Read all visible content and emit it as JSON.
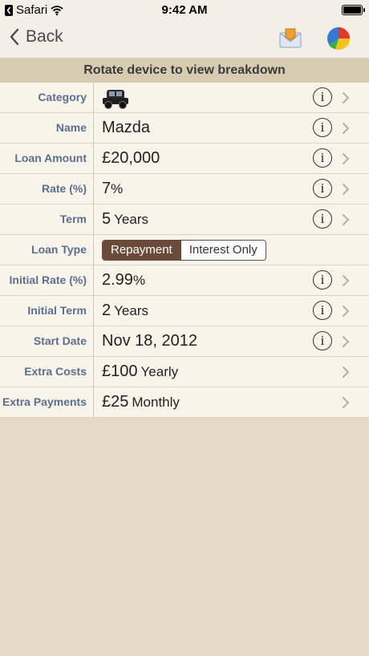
{
  "status_bar": {
    "app": "Safari",
    "time": "9:42 AM"
  },
  "nav": {
    "back_label": "Back",
    "mail_icon": "mail-envelope-icon",
    "chart_icon": "pie-chart-icon"
  },
  "banner": "Rotate device to view breakdown",
  "rows": {
    "category": {
      "label": "Category"
    },
    "name": {
      "label": "Name",
      "value": "Mazda"
    },
    "loan_amount": {
      "label": "Loan Amount",
      "value": "£20,000"
    },
    "rate": {
      "label": "Rate (%)",
      "value": "7",
      "unit": "%"
    },
    "term": {
      "label": "Term",
      "value": "5",
      "unit": "Years"
    },
    "loan_type": {
      "label": "Loan Type",
      "options": [
        "Repayment",
        "Interest Only"
      ],
      "selected": "Repayment"
    },
    "initial_rate": {
      "label": "Initial Rate (%)",
      "value": "2.99",
      "unit": "%"
    },
    "initial_term": {
      "label": "Initial Term",
      "value": "2",
      "unit": "Years"
    },
    "start_date": {
      "label": "Start Date",
      "value": "Nov 18, 2012"
    },
    "extra_costs": {
      "label": "Extra Costs",
      "value": "£100",
      "unit": "Yearly"
    },
    "extra_payments": {
      "label": "Extra Payments",
      "value": "£25",
      "unit": "Monthly"
    }
  },
  "info_glyph": "i"
}
